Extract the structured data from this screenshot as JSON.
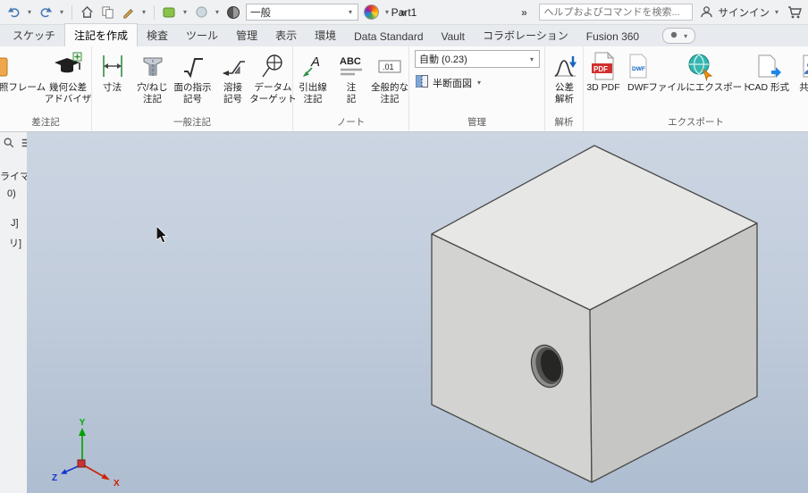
{
  "titlebar": {
    "title": "Part1",
    "appearance_value": "一般",
    "search_placeholder": "ヘルプおよびコマンドを検索...",
    "sign_in_label": "サインイン"
  },
  "tabs": {
    "items": [
      "スケッチ",
      "注記を作成",
      "検査",
      "ツール",
      "管理",
      "表示",
      "環境",
      "Data Standard",
      "Vault",
      "コラボレーション",
      "Fusion 360"
    ],
    "active": "注記を作成"
  },
  "ribbon": {
    "tolerance_panel": {
      "label": "差注記",
      "ref_frame_label": "照フレーム",
      "advisor_line1": "幾何公差",
      "advisor_line2": "アドバイザ"
    },
    "general_panel": {
      "label": "一般注記",
      "dimension_label": "寸法",
      "hole_line1": "穴/ねじ",
      "hole_line2": "注記",
      "surface_line1": "面の指示",
      "surface_line2": "記号",
      "weld_line1": "溶接",
      "weld_line2": "記号",
      "datum_line1": "データム",
      "datum_line2": "ターゲット"
    },
    "note_panel": {
      "label": "ノート",
      "leader_line1": "引出線",
      "leader_line2": "注記",
      "note_line1": "注",
      "note_line2": "記",
      "general_line1": "全般的な",
      "general_line2": "注記"
    },
    "manage_panel": {
      "label": "管理",
      "combo_value": "自動 (0.23)",
      "section_label": "半断面図"
    },
    "analysis_panel": {
      "label": "解析",
      "tol_line1": "公差",
      "tol_line2": "解析"
    },
    "export_panel": {
      "label": "エクスポート",
      "pdf_label": "3D PDF",
      "dwf_label": "DWF",
      "file_label": "ファイルにエクスポート",
      "cad_label": "CAD 形式",
      "shared_label": "共有ビ"
    }
  },
  "browser": {
    "fragments": [
      "ライマリ]",
      "0)",
      "J]",
      "リ]"
    ]
  },
  "viewport": {
    "axes": {
      "x": "X",
      "y": "Y",
      "z": "Z"
    },
    "cube": {
      "top": "#e7e7e5",
      "front": "#d3d3d1",
      "side": "#c6c6c4"
    }
  }
}
